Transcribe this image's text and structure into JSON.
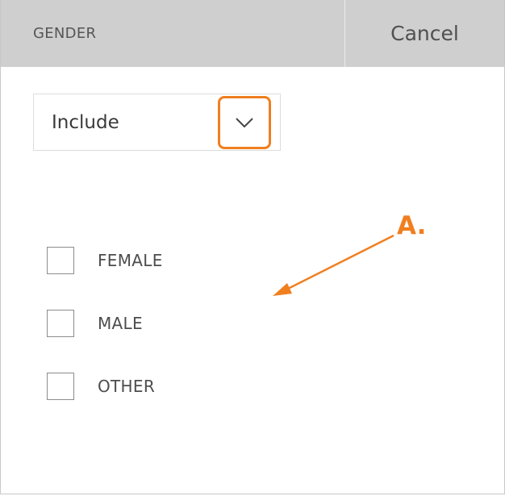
{
  "header": {
    "title": "GENDER",
    "cancel_label": "Cancel"
  },
  "filter": {
    "mode_value": "Include",
    "toggle_icon": "chevron-down-icon"
  },
  "options": [
    {
      "label": "FEMALE",
      "checked": false
    },
    {
      "label": "MALE",
      "checked": false
    },
    {
      "label": "OTHER",
      "checked": false
    }
  ],
  "annotation": {
    "label": "A.",
    "color": "#f07f1f"
  }
}
